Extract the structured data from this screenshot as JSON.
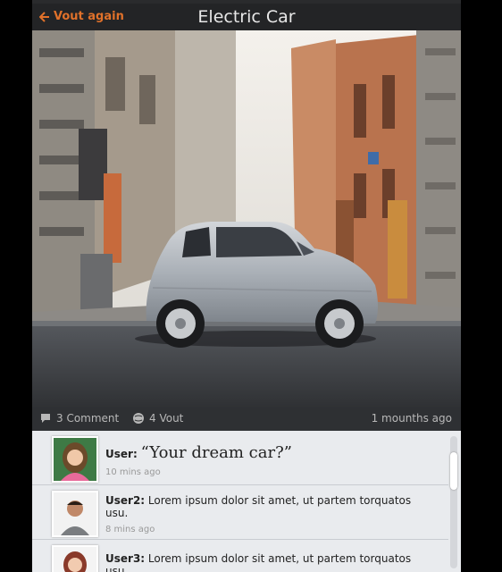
{
  "header": {
    "back_label": "Vout again",
    "title": "Electric Car"
  },
  "stats": {
    "comments": "3 Comment",
    "votes": "4 Vout",
    "ago": "1 mounths ago"
  },
  "comments": [
    {
      "user": "User:",
      "text": "“Your dream car?”",
      "time": "10 mins ago"
    },
    {
      "user": "User2:",
      "text": "Lorem ipsum dolor sit amet, ut partem torquatos usu.",
      "time": "8 mins ago"
    },
    {
      "user": "User3:",
      "text": "Lorem ipsum dolor sit amet, ut partem torquatos usu.",
      "time": ""
    }
  ],
  "colors": {
    "accent": "#e0712a",
    "header_bg": "#232426",
    "list_bg": "#e9ebee"
  }
}
